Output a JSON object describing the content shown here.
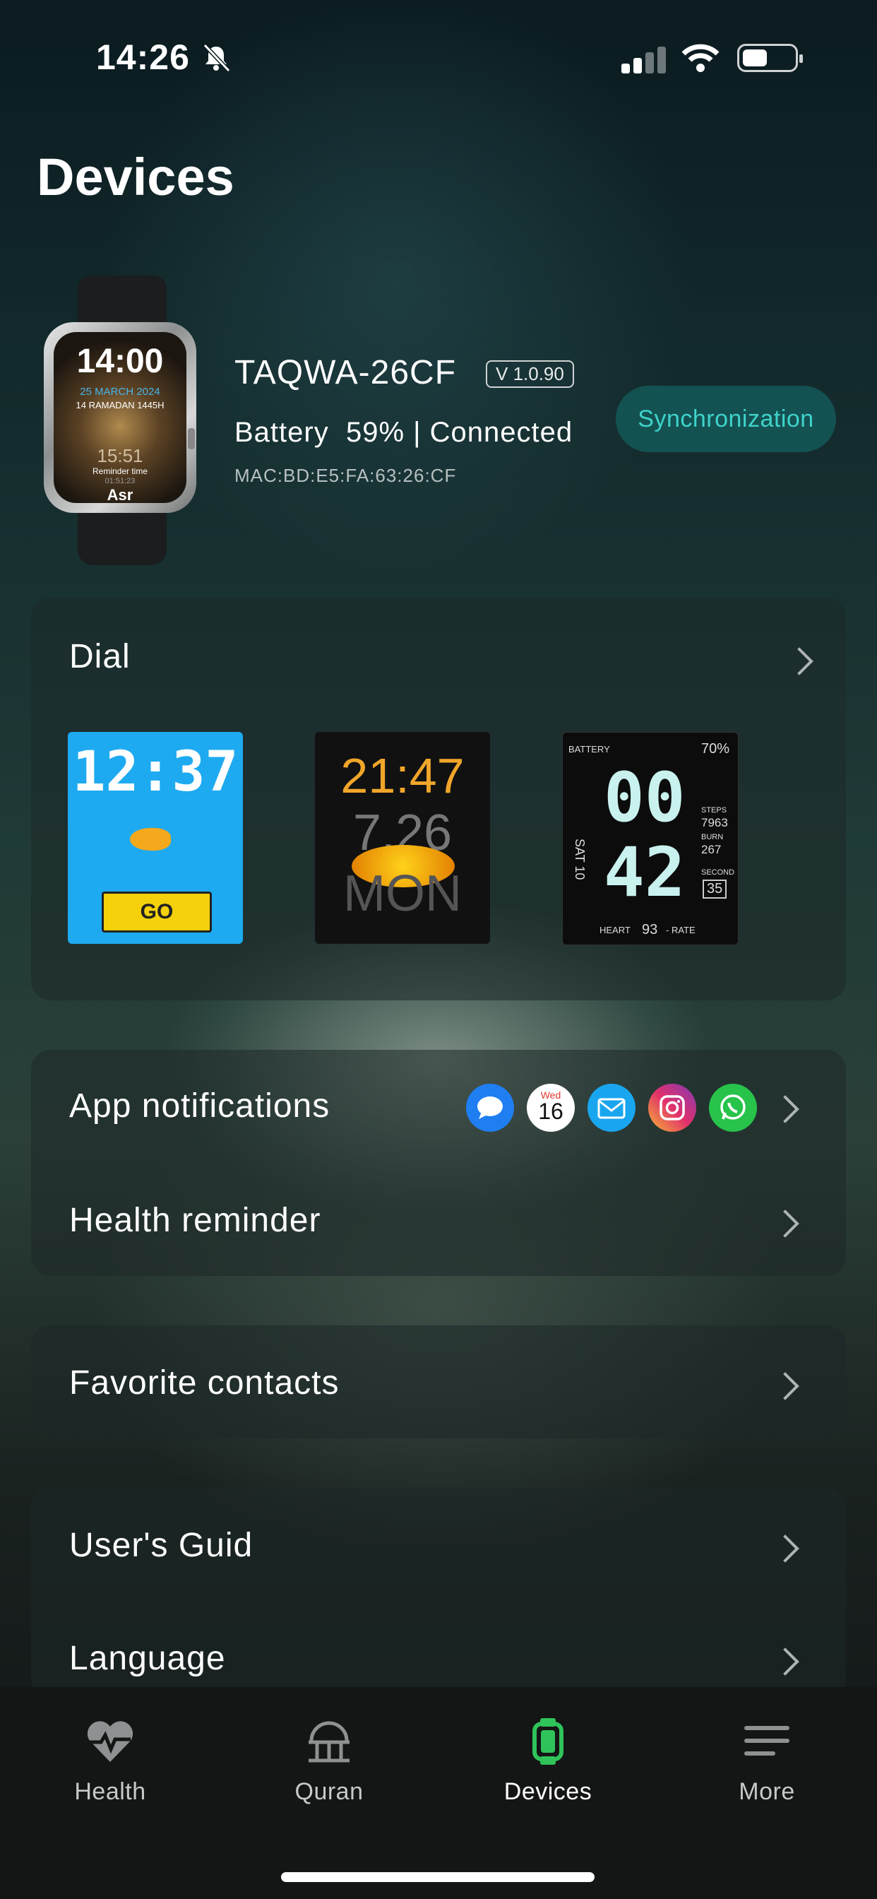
{
  "status_bar": {
    "time": "14:26"
  },
  "page": {
    "title": "Devices"
  },
  "device": {
    "name": "TAQWA-26CF",
    "version": "V 1.0.90",
    "battery_label": "Battery",
    "battery_value": "59% | Connected",
    "mac": "MAC:BD:E5:FA:63:26:CF",
    "sync_label": "Synchronization",
    "watch_face": {
      "time": "14:00",
      "date": "25 MARCH 2024",
      "hijri": "14 RAMADAN 1445H",
      "countdown": "15:51",
      "reminder": "Reminder time",
      "clock": "01:51:23",
      "prayer": "Asr"
    }
  },
  "dial": {
    "label": "Dial",
    "faces": [
      {
        "time": "12:37",
        "button": "GO"
      },
      {
        "time": "21:47",
        "date": "7.26",
        "day": "MON"
      },
      {
        "battery_label": "BATTERY",
        "battery": "70%",
        "day": "SAT 10",
        "hour": "00",
        "minute": "42",
        "steps_label": "STEPS",
        "steps": "7963",
        "burn_label": "BURN",
        "burn": "267",
        "second_label": "SECOND",
        "second": "35",
        "heart_label": "HEART",
        "heart": "93",
        "rate_label": "- RATE"
      }
    ]
  },
  "settings": {
    "app_notifications": "App notifications",
    "calendar_day": "Wed",
    "calendar_date": "16",
    "health_reminder": "Health reminder",
    "favorite_contacts": "Favorite contacts",
    "users_guide": "User's Guid",
    "language": "Language"
  },
  "tabs": [
    {
      "label": "Health",
      "icon": "heart-pulse-icon"
    },
    {
      "label": "Quran",
      "icon": "mosque-icon"
    },
    {
      "label": "Devices",
      "icon": "watch-icon",
      "active": true
    },
    {
      "label": "More",
      "icon": "menu-icon"
    }
  ],
  "colors": {
    "accent": "#3ed3c9",
    "active_tab": "#2fc35a"
  }
}
